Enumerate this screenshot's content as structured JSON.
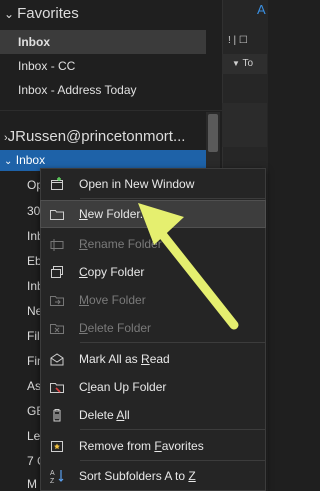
{
  "favorites": {
    "header": "Favorites",
    "items": [
      {
        "label": "Inbox",
        "selected": true
      },
      {
        "label": "Inbox - CC"
      },
      {
        "label": "Inbox - Address Today"
      }
    ]
  },
  "account": {
    "header": "JRussen@princetonmort...",
    "inbox_label": "Inbox",
    "truncated_folders": [
      "Op",
      "30",
      "Inb",
      "Eb",
      "Inb",
      "Ne",
      "Fil",
      "Fin",
      "As",
      "GE",
      "Le",
      "7 C",
      "M"
    ]
  },
  "right_pane": {
    "tab_label": "A",
    "header_symbols": "! | ☐",
    "group_label": "To"
  },
  "context_menu": {
    "items": [
      {
        "label": "Open in New Window",
        "u": "",
        "icon": "open-window-icon",
        "enabled": true
      },
      {
        "label_pre": "",
        "u": "N",
        "label_post": "ew Folder...",
        "icon": "new-folder-icon",
        "enabled": true,
        "hovered": true
      },
      {
        "label_pre": "",
        "u": "R",
        "label_post": "ename Folder",
        "icon": "rename-folder-icon",
        "enabled": false
      },
      {
        "label_pre": "",
        "u": "C",
        "label_post": "opy Folder",
        "icon": "copy-folder-icon",
        "enabled": true
      },
      {
        "label_pre": "",
        "u": "M",
        "label_post": "ove Folder",
        "icon": "move-folder-icon",
        "enabled": false
      },
      {
        "label_pre": "",
        "u": "D",
        "label_post": "elete Folder",
        "icon": "delete-folder-icon",
        "enabled": false
      },
      {
        "label_pre": "Mark All as ",
        "u": "R",
        "label_post": "ead",
        "icon": "mark-read-icon",
        "enabled": true
      },
      {
        "label_pre": "C",
        "u": "l",
        "label_post": "ean Up Folder",
        "icon": "clean-up-icon",
        "enabled": true
      },
      {
        "label_pre": "Delete ",
        "u": "A",
        "label_post": "ll",
        "icon": "delete-all-icon",
        "enabled": true
      },
      {
        "label_pre": "Remove from ",
        "u": "F",
        "label_post": "avorites",
        "icon": "favorites-star-icon",
        "enabled": true
      },
      {
        "label_pre": "Sort Subfolders A to ",
        "u": "Z",
        "label_post": "",
        "icon": "sort-az-icon",
        "enabled": true
      }
    ]
  },
  "annotation": {
    "arrow_color": "#e5ef6f"
  },
  "colors": {
    "selection_blue": "#1e62a8",
    "accent_blue": "#3a8fe0"
  }
}
